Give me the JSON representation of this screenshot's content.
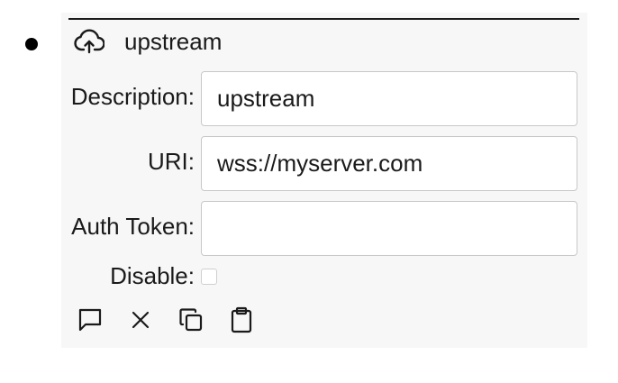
{
  "item": {
    "title": "upstream",
    "icon": "cloud-upload-icon"
  },
  "form": {
    "description_label": "Description:",
    "description_value": "upstream",
    "uri_label": "URI:",
    "uri_value": "wss://myserver.com",
    "auth_token_label": "Auth Token:",
    "auth_token_value": "",
    "disable_label": "Disable:",
    "disable_checked": false
  },
  "toolbar": {
    "icons": [
      "comment-icon",
      "close-icon",
      "copy-icon",
      "paste-icon"
    ]
  }
}
